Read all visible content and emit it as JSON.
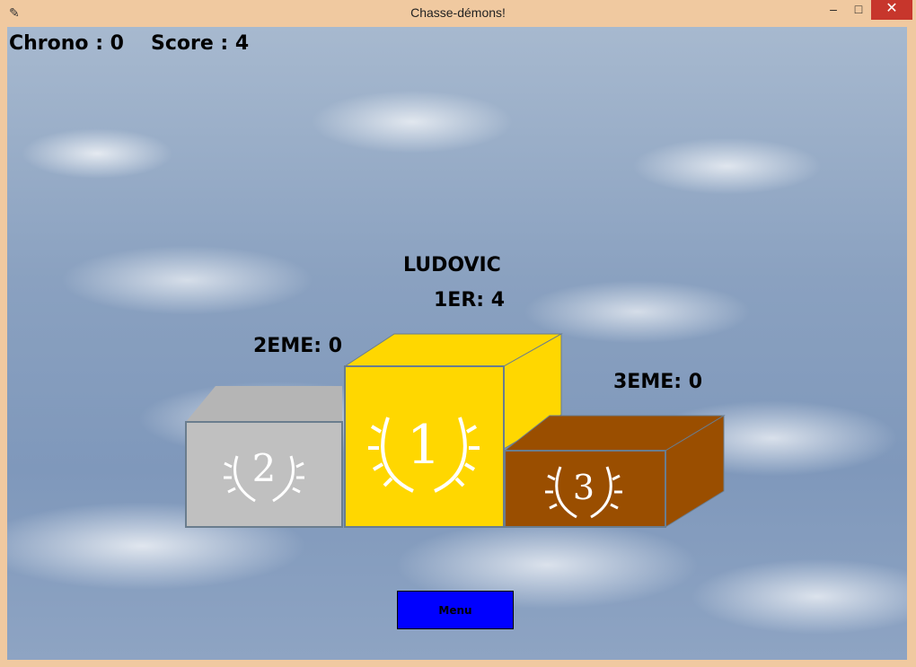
{
  "window": {
    "title": "Chasse-démons!",
    "icon": "feather-icon",
    "controls": {
      "minimize": "–",
      "maximize": "□",
      "close": "✕"
    }
  },
  "hud": {
    "chrono": "Chrono : 0",
    "score": "Score : 4"
  },
  "podium": {
    "first": {
      "player": "LUDOVIC",
      "label": "1ER: 4",
      "rank": "1",
      "color": "#ffd700"
    },
    "second": {
      "label": "2EME: 0",
      "rank": "2",
      "color": "#c0c0c0"
    },
    "third": {
      "label": "3EME: 0",
      "rank": "3",
      "color": "#9a4e00"
    }
  },
  "menu": {
    "label": "Menu",
    "color": "#0000ff"
  }
}
